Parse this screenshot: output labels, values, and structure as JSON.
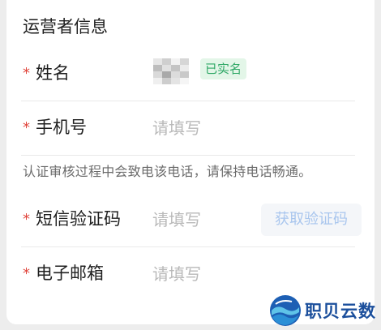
{
  "section": {
    "title": "运营者信息"
  },
  "fields": {
    "name": {
      "required_mark": "*",
      "label": "姓名",
      "verified_badge": "已实名"
    },
    "phone": {
      "required_mark": "*",
      "label": "手机号",
      "placeholder": "请填写"
    },
    "sms": {
      "required_mark": "*",
      "label": "短信验证码",
      "placeholder": "请填写",
      "button": "获取验证码"
    },
    "email": {
      "required_mark": "*",
      "label": "电子邮箱",
      "placeholder": "请填写"
    }
  },
  "notice": "认证审核过程中会致电该电话，请保持电话畅通。",
  "watermark": {
    "text": "职贝云数"
  },
  "colors": {
    "required": "#e0453c",
    "verified_bg": "#e3f6e8",
    "verified_text": "#2fa866",
    "button_text": "#a9c6ee"
  }
}
